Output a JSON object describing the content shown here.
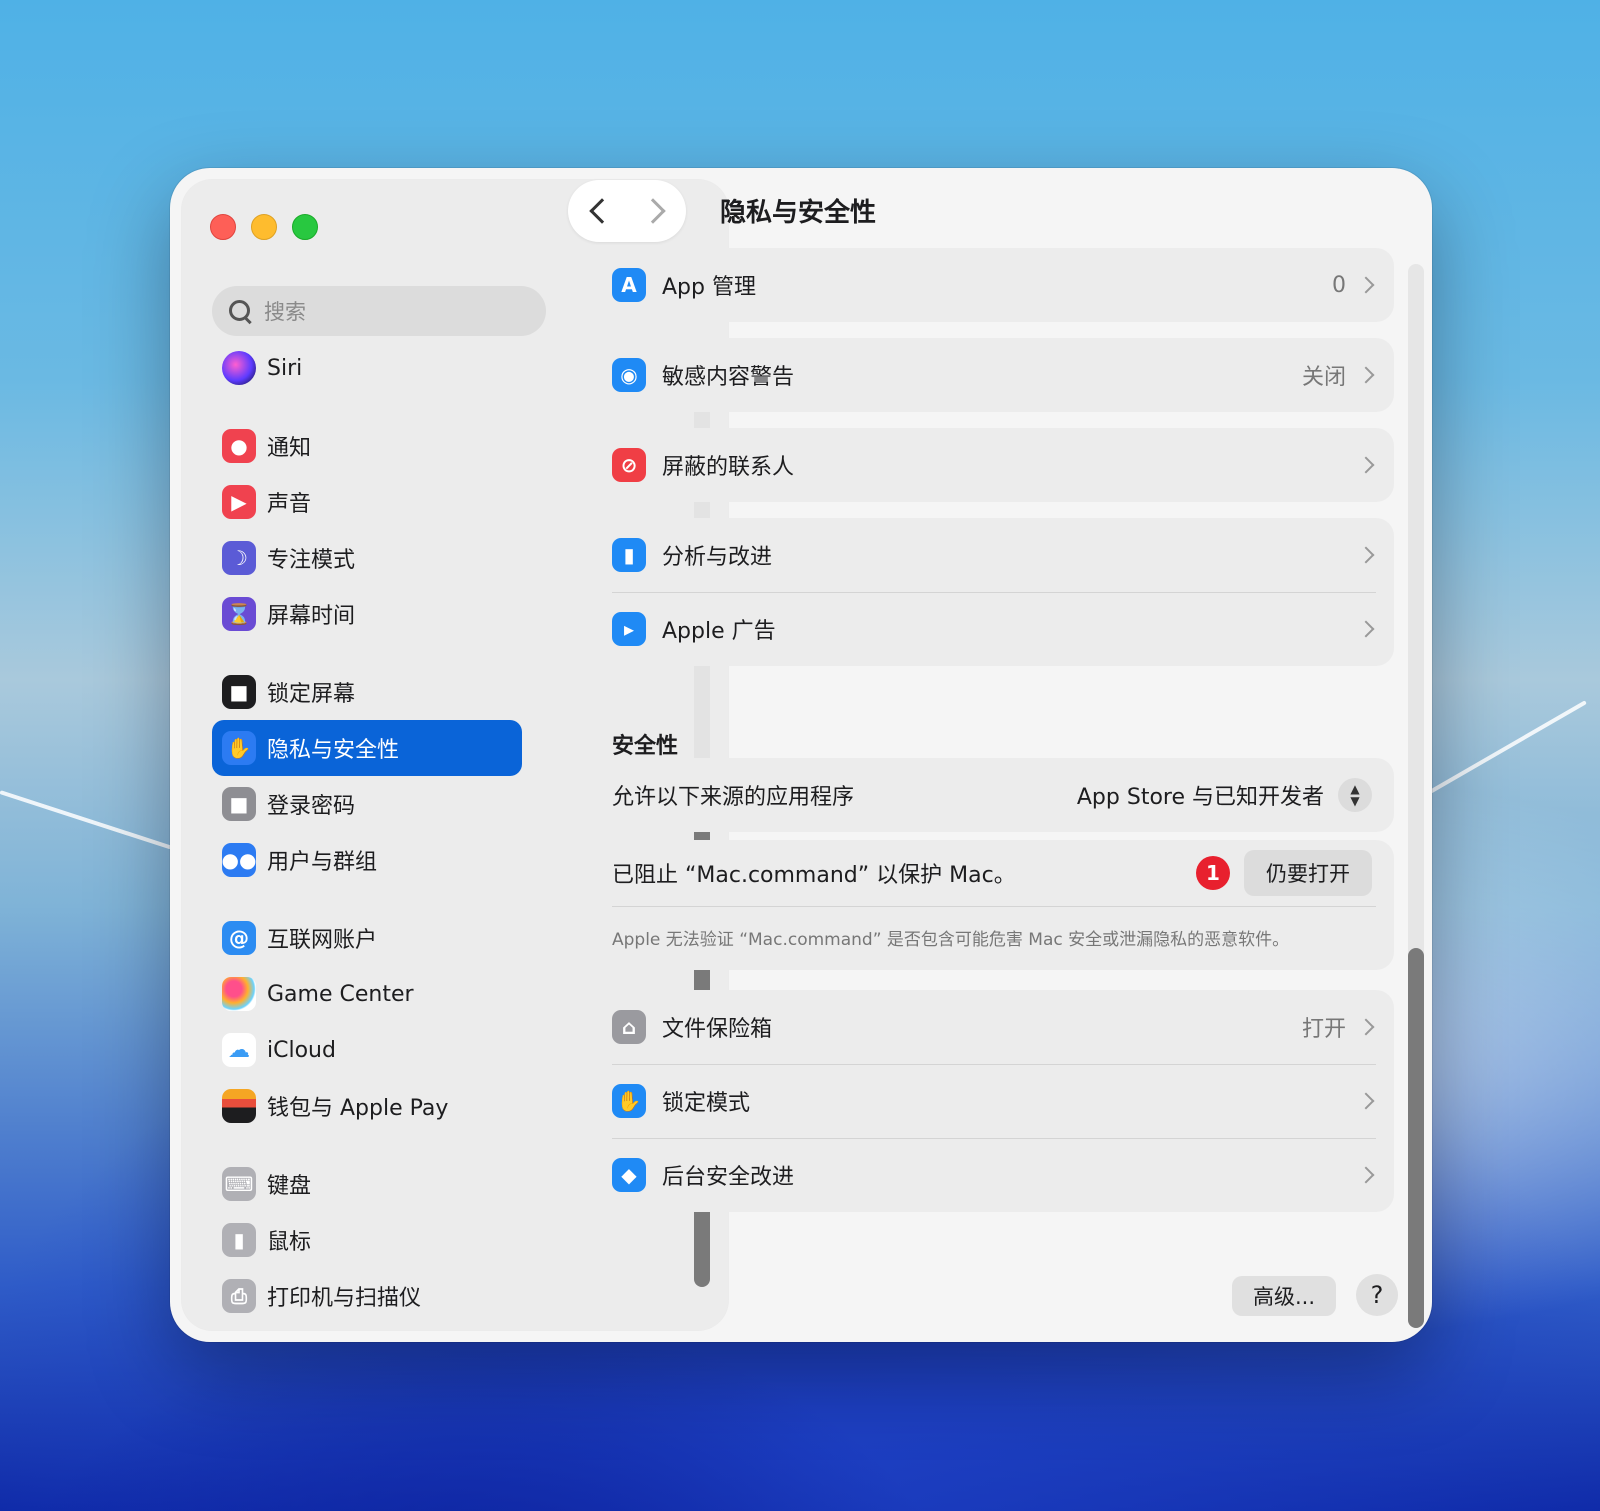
{
  "window": {
    "title": "隐私与安全性"
  },
  "search": {
    "placeholder": "搜索"
  },
  "sidebar": {
    "items": [
      {
        "label": "Siri",
        "icon": "siri-icon",
        "color": "#3b2a7a"
      },
      {
        "label": "通知",
        "icon": "bell-icon",
        "color": "#f0424f"
      },
      {
        "label": "声音",
        "icon": "speaker-icon",
        "color": "#f0424f"
      },
      {
        "label": "专注模式",
        "icon": "moon-icon",
        "color": "#5b5bd6"
      },
      {
        "label": "屏幕时间",
        "icon": "hourglass-icon",
        "color": "#6a4bd4"
      },
      {
        "label": "锁定屏幕",
        "icon": "lock-screen-icon",
        "color": "#1d1d1f"
      },
      {
        "label": "隐私与安全性",
        "icon": "hand-icon",
        "color": "#2c7bf2",
        "active": true
      },
      {
        "label": "登录密码",
        "icon": "lock-icon",
        "color": "#8e8e93"
      },
      {
        "label": "用户与群组",
        "icon": "users-icon",
        "color": "#2c7bf2"
      },
      {
        "label": "互联网账户",
        "icon": "at-icon",
        "color": "#2c8cf2"
      },
      {
        "label": "Game Center",
        "icon": "game-center-icon",
        "color": "#ffffff"
      },
      {
        "label": "iCloud",
        "icon": "cloud-icon",
        "color": "#ffffff"
      },
      {
        "label": "钱包与 Apple Pay",
        "icon": "wallet-icon",
        "color": "#1d1d1f"
      },
      {
        "label": "键盘",
        "icon": "keyboard-icon",
        "color": "#b0b0b5"
      },
      {
        "label": "鼠标",
        "icon": "mouse-icon",
        "color": "#b0b0b5"
      },
      {
        "label": "打印机与扫描仪",
        "icon": "printer-icon",
        "color": "#b0b0b5"
      }
    ]
  },
  "main": {
    "groups": [
      {
        "rows": [
          {
            "label": "App 管理",
            "value": "0",
            "icon": "app-store-icon",
            "color": "#1f8af5"
          }
        ]
      },
      {
        "rows": [
          {
            "label": "敏感内容警告",
            "value": "关闭",
            "icon": "eye-warning-icon",
            "color": "#1f8af5"
          }
        ]
      },
      {
        "rows": [
          {
            "label": "屏蔽的联系人",
            "value": "",
            "icon": "blocked-icon",
            "color": "#f03e45"
          }
        ]
      },
      {
        "rows": [
          {
            "label": "分析与改进",
            "value": "",
            "icon": "chart-icon",
            "color": "#1f8af5"
          },
          {
            "label": "Apple 广告",
            "value": "",
            "icon": "megaphone-icon",
            "color": "#1f8af5"
          }
        ]
      }
    ],
    "security": {
      "title": "安全性",
      "allow_label": "允许以下来源的应用程序",
      "allow_value": "App Store 与已知开发者",
      "blocked_text": "已阻止 “Mac.command” 以保护 Mac。",
      "badge_count": "1",
      "open_anyway": "仍要打开",
      "note": "Apple 无法验证 “Mac.command” 是否包含可能危害 Mac 安全或泄漏隐私的恶意软件。"
    },
    "lower_rows": [
      {
        "label": "文件保险箱",
        "value": "打开",
        "icon": "vault-icon",
        "color": "#9a9a9f"
      },
      {
        "label": "锁定模式",
        "value": "",
        "icon": "hand-icon",
        "color": "#1f8af5"
      },
      {
        "label": "后台安全改进",
        "value": "",
        "icon": "shield-icon",
        "color": "#1f8af5"
      }
    ],
    "advanced_button": "高级...",
    "help_button": "?"
  }
}
